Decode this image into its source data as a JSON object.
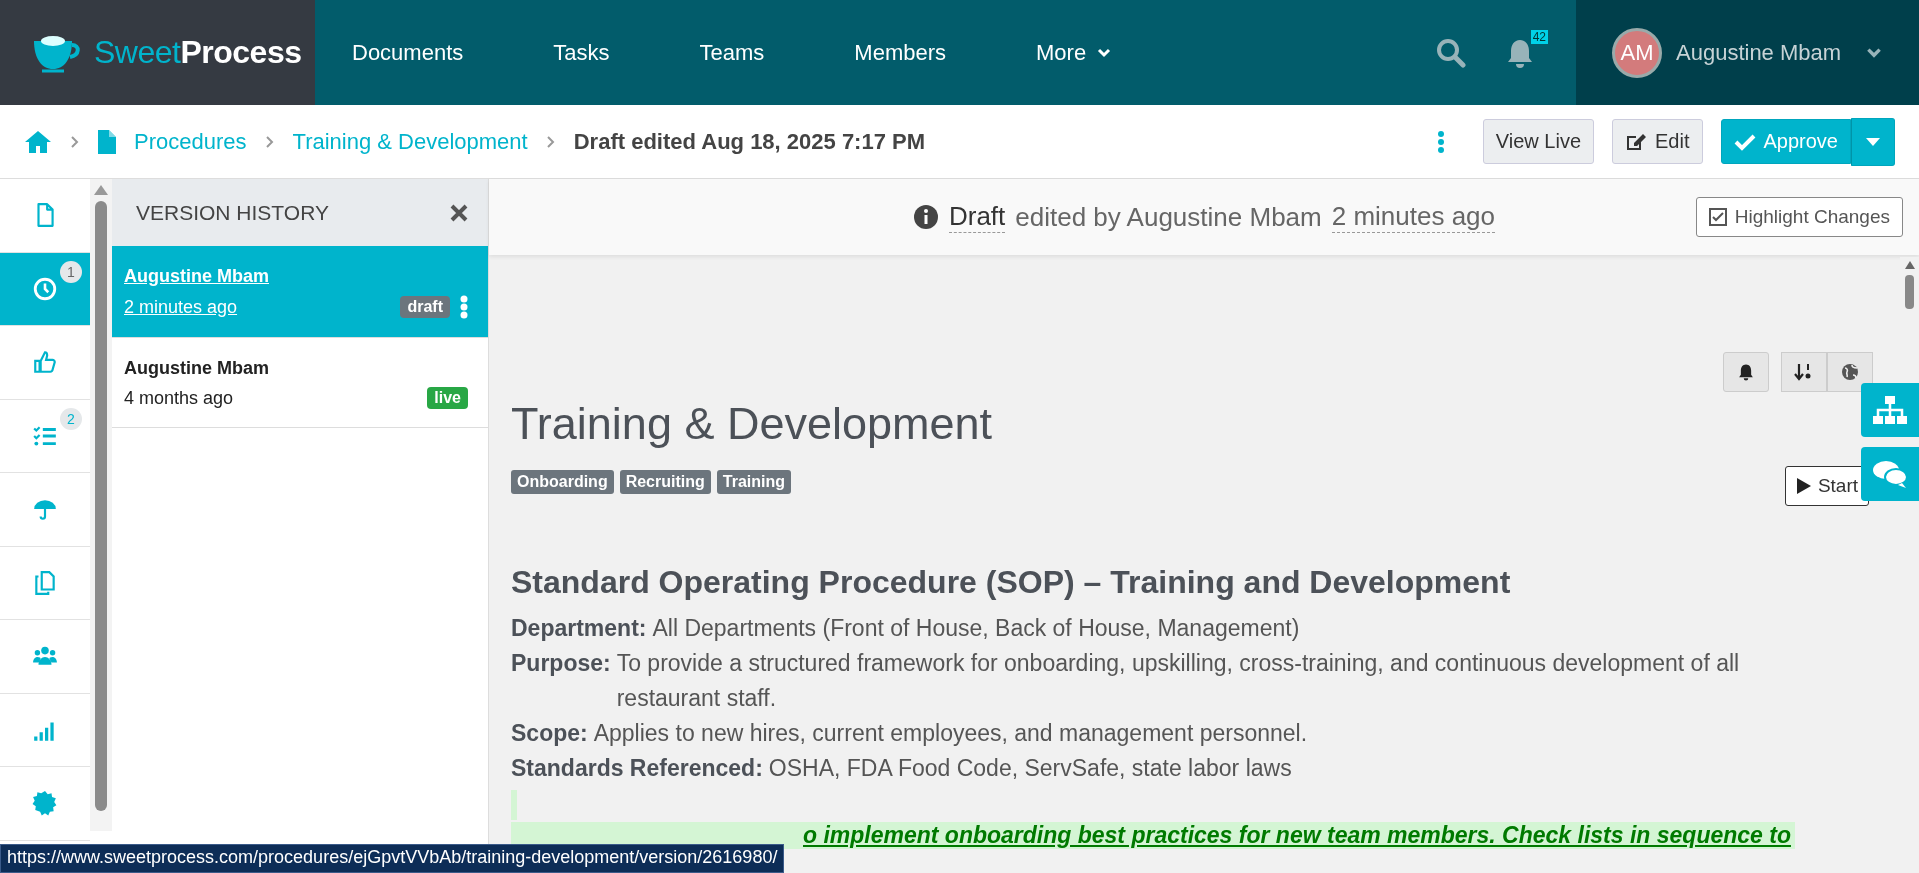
{
  "nav": {
    "logo": "Sweet**Process**",
    "items": [
      {
        "label": "Documents",
        "kind": "link"
      },
      {
        "label": "Tasks",
        "kind": "link"
      },
      {
        "label": "Teams",
        "kind": "link"
      },
      {
        "label": "Members",
        "kind": "link"
      },
      {
        "label": "More",
        "kind": "dropdown"
      }
    ],
    "notification_count": "42",
    "user": {
      "initials": "AM",
      "name": "Augustine Mbam"
    }
  },
  "breadcrumb": {
    "items": [
      "Procedures",
      "Training & Development"
    ],
    "current": "Draft edited Aug 18, 2025 7:17 PM"
  },
  "actions": [
    {
      "label": "View Live",
      "kind": "plain"
    },
    {
      "label": "Edit",
      "kind": "edit"
    },
    {
      "label": "Approve",
      "kind": "primary"
    }
  ],
  "sidebar": {
    "items": [
      {
        "selected": false
      },
      {
        "selected": true,
        "badge": "1"
      },
      {
        "selected": false
      },
      {
        "selected": false,
        "badge": "2"
      },
      {
        "selected": false
      },
      {
        "selected": false
      },
      {
        "selected": false
      },
      {
        "selected": false
      },
      {
        "selected": false
      }
    ]
  },
  "version_history": {
    "title": "VERSION HISTORY",
    "versions": [
      {
        "author": "Augustine Mbam",
        "time": "2 minutes ago",
        "badge": "draft",
        "kind": "draft",
        "selected": true
      },
      {
        "author": "Augustine Mbam",
        "time": "4 months ago",
        "badge": "live",
        "kind": "live",
        "selected": false
      }
    ]
  },
  "status_header": {
    "state": "Draft",
    "by": "edited by Augustine Mbam",
    "time": "2 minutes ago",
    "button": "Highlight Changes"
  },
  "document": {
    "title": "Training & Development",
    "tags": [
      "Onboarding",
      "Recruiting",
      "Training"
    ],
    "start_button": "Start",
    "heading": "Standard Operating Procedure (SOP) – Training and Development",
    "fields": [
      {
        "label": "Department:",
        "value": "All Departments (Front of House, Back of House, Management)"
      },
      {
        "label": "Purpose:",
        "value": "To provide a structured framework for onboarding, upskilling, cross-training, and continuous development of all restaurant staff."
      },
      {
        "label": "Scope:",
        "value": "Applies to new hires, current employees, and management personnel."
      },
      {
        "label": "Standards Referenced:",
        "value": "OSHA, FDA Food Code, ServSafe, state labor laws"
      }
    ],
    "note": "o implement onboarding best practices for new team members. Check lists in sequence to"
  },
  "status_url": "https://www.sweetprocess.com/procedures/ejGpvtVVbAb/training-development/version/2616980/"
}
